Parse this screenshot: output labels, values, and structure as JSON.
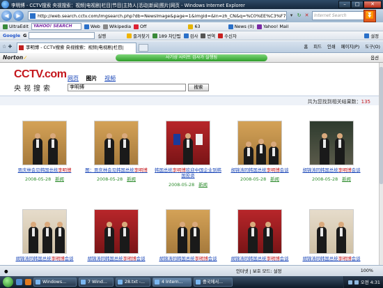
{
  "window": {
    "title": "李明博 - CCTV搜索 央视搜索：视频|电视剧|栏目|节目|主持人|活动|新闻|图片|网页 - Windows Internet Explorer"
  },
  "address_bar": {
    "url": "http://web.search.cctv.com/imgsearch.php?db=NewsImage&page=1&imgid=&ln=zh_CN&q=%C0%EE%C3%F7",
    "search_placeholder": "Internet Search"
  },
  "toolbar1": {
    "ultraedit": "UltraEdit",
    "yahoo_search": "YAHOO! SEARCH",
    "web": "Web",
    "wikipedia": "Wikipedia",
    "off": "Off",
    "count63": "63",
    "news": "News (0)",
    "yahoo_mail": "Yahoo! Mail"
  },
  "toolbar2": {
    "google": "Google",
    "g_label": "G",
    "search_btn": "실행",
    "favorites": "즐겨찾기",
    "blocked": "189 차단됨",
    "check": "검사",
    "translate": "번역",
    "send": "수신자",
    "settings": "설정"
  },
  "tabs": {
    "active_tab": "李明博 - CCTV搜索 央视搜索：视频|电视剧|栏目|",
    "home": "홈",
    "feeds": "피드",
    "print": "인쇄",
    "page": "페이지(P)",
    "tools": "도구(O)"
  },
  "norton": {
    "logo": "Norton",
    "status": "사기성 사이트 검사가 실행됨",
    "options": "옵션"
  },
  "cctv": {
    "logo_text": "CCTV.com",
    "logo_sub": "央视搜索",
    "search_tabs": [
      "网页",
      "图片",
      "视频"
    ],
    "query": "李明博",
    "search_button": "搜索",
    "result_label": "共为您找到相关结果数：",
    "result_count": "135"
  },
  "results": [
    {
      "caption_pre": "贾庆林会见韩国总统",
      "highlight": "李明博",
      "caption_post": "",
      "date": "2008-05-28",
      "category": "新闻"
    },
    {
      "caption_pre": "图：贾庆林会见韩国总统",
      "highlight": "李明博",
      "caption_post": "",
      "date": "2008-05-28",
      "category": "新闻"
    },
    {
      "caption_pre": "韩国总统",
      "highlight": "李明博",
      "caption_post": "欢迎中国企业到韩国投资",
      "date": "2008-05-28",
      "category": "新闻"
    },
    {
      "caption_pre": "胡锦涛同韩国总统",
      "highlight": "李明博",
      "caption_post": "会谈",
      "date": "2008-05-28",
      "category": "新闻"
    },
    {
      "caption_pre": "胡锦涛同韩国总统",
      "highlight": "李明博",
      "caption_post": "会谈",
      "date": "2008-05-28",
      "category": "新闻"
    },
    {
      "caption_pre": "胡锦涛同韩国总统",
      "highlight": "李明博",
      "caption_post": "会谈",
      "date": "",
      "category": ""
    },
    {
      "caption_pre": "胡锦涛同韩国总统",
      "highlight": "李明博",
      "caption_post": "会谈",
      "date": "",
      "category": ""
    },
    {
      "caption_pre": "胡锦涛同韩国总统",
      "highlight": "李明博",
      "caption_post": "会谈",
      "date": "",
      "category": ""
    },
    {
      "caption_pre": "胡锦涛同韩国总统",
      "highlight": "李明博",
      "caption_post": "会谈",
      "date": "",
      "category": ""
    },
    {
      "caption_pre": "胡锦涛同韩国总统",
      "highlight": "李明博",
      "caption_post": "会谈",
      "date": "",
      "category": ""
    }
  ],
  "statusbar": {
    "zone": "인터넷 | 보호 모드: 설정",
    "zoom": "100%"
  },
  "taskbar": {
    "tasks": [
      "Windows...",
      "7 Wind...",
      "28.txt -...",
      "4 Intern...",
      "중국에서..."
    ],
    "clock": "오전 4:31"
  },
  "colors": {
    "cctv_red": "#c4161c",
    "link_blue": "#1b47b8",
    "date_green": "#2a8a2a"
  }
}
